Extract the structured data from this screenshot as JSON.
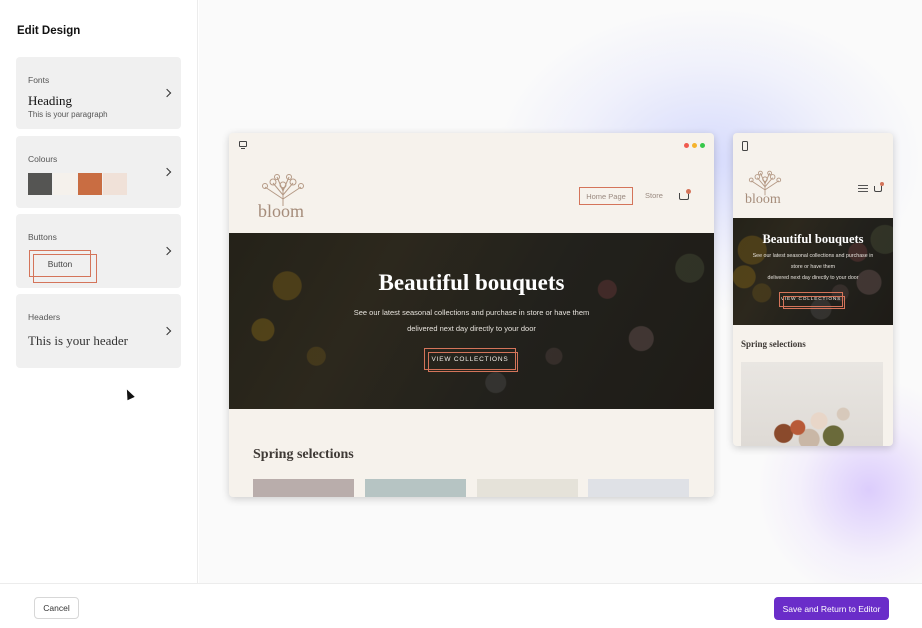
{
  "panel": {
    "title": "Edit Design",
    "fonts": {
      "label": "Fonts",
      "heading": "Heading",
      "paragraph": "This is your paragraph"
    },
    "colours": {
      "label": "Colours",
      "swatches": [
        "#555553",
        "#f5f1ec",
        "#c96d42",
        "#f0e1d8"
      ]
    },
    "buttons": {
      "label": "Buttons",
      "sample": "Button"
    },
    "headers": {
      "label": "Headers",
      "sample": "This is your header"
    }
  },
  "preview": {
    "brand": "bloom",
    "nav": {
      "home": "Home Page",
      "store": "Store"
    },
    "window_dots": [
      "#f05b4f",
      "#f5b32c",
      "#37c84a"
    ],
    "hero": {
      "title": "Beautiful bouquets",
      "subtitle_line1": "See our latest seasonal collections and purchase in store or have them",
      "subtitle_line2": "delivered next day directly to your door",
      "button": "VIEW COLLECTIONS"
    },
    "mobile_hero": {
      "line1": "See our latest seasonal collections and purchase in",
      "line2": "store or have them",
      "line3": "delivered next day directly to your door"
    },
    "section_title": "Spring selections",
    "thumb_colors": [
      "#b9adab",
      "#b6c4c3",
      "#e5e2d9",
      "#dfe1e6"
    ]
  },
  "footer": {
    "cancel": "Cancel",
    "save": "Save and Return to Editor"
  }
}
